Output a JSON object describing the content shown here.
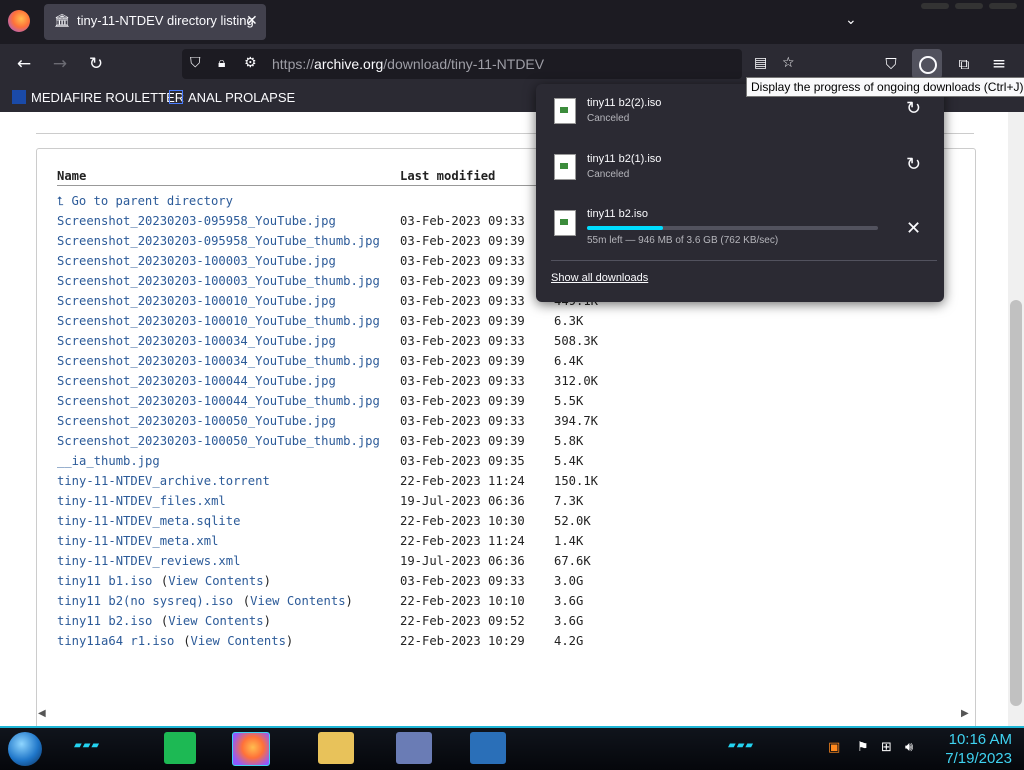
{
  "tab": {
    "title": "tiny-11-NTDEV directory listing",
    "close": "✕",
    "icon": "archive-icon"
  },
  "tab_list_icon": "⌄",
  "nav": {
    "back": "←",
    "forward": "→",
    "reload": "↻",
    "url_prefix": "https://",
    "url_host": "archive.org",
    "url_path": "/download/tiny-11-NTDEV"
  },
  "bookmarks": [
    {
      "label": "MEDIAFIRE ROULETTER"
    },
    {
      "label": "ANAL PROLAPSE"
    }
  ],
  "listing": {
    "headers": {
      "name": "Name",
      "modified": "Last modified"
    },
    "parent": "Go to parent directory",
    "view_contents": "View Contents",
    "rows": [
      {
        "name": "Screenshot_20230203-095958_YouTube.jpg",
        "date": "03-Feb-2023 09:33",
        "size": ""
      },
      {
        "name": "Screenshot_20230203-095958_YouTube_thumb.jpg",
        "date": "03-Feb-2023 09:39",
        "size": ""
      },
      {
        "name": "Screenshot_20230203-100003_YouTube.jpg",
        "date": "03-Feb-2023 09:33",
        "size": ""
      },
      {
        "name": "Screenshot_20230203-100003_YouTube_thumb.jpg",
        "date": "03-Feb-2023 09:39",
        "size": ""
      },
      {
        "name": "Screenshot_20230203-100010_YouTube.jpg",
        "date": "03-Feb-2023 09:33",
        "size": "449.1K"
      },
      {
        "name": "Screenshot_20230203-100010_YouTube_thumb.jpg",
        "date": "03-Feb-2023 09:39",
        "size": "6.3K"
      },
      {
        "name": "Screenshot_20230203-100034_YouTube.jpg",
        "date": "03-Feb-2023 09:33",
        "size": "508.3K"
      },
      {
        "name": "Screenshot_20230203-100034_YouTube_thumb.jpg",
        "date": "03-Feb-2023 09:39",
        "size": "6.4K"
      },
      {
        "name": "Screenshot_20230203-100044_YouTube.jpg",
        "date": "03-Feb-2023 09:33",
        "size": "312.0K"
      },
      {
        "name": "Screenshot_20230203-100044_YouTube_thumb.jpg",
        "date": "03-Feb-2023 09:39",
        "size": "5.5K"
      },
      {
        "name": "Screenshot_20230203-100050_YouTube.jpg",
        "date": "03-Feb-2023 09:33",
        "size": "394.7K"
      },
      {
        "name": "Screenshot_20230203-100050_YouTube_thumb.jpg",
        "date": "03-Feb-2023 09:39",
        "size": "5.8K"
      },
      {
        "name": "__ia_thumb.jpg",
        "date": "03-Feb-2023 09:35",
        "size": "5.4K"
      },
      {
        "name": "tiny-11-NTDEV_archive.torrent",
        "date": "22-Feb-2023 11:24",
        "size": "150.1K"
      },
      {
        "name": "tiny-11-NTDEV_files.xml",
        "date": "19-Jul-2023 06:36",
        "size": "7.3K"
      },
      {
        "name": "tiny-11-NTDEV_meta.sqlite",
        "date": "22-Feb-2023 10:30",
        "size": "52.0K"
      },
      {
        "name": "tiny-11-NTDEV_meta.xml",
        "date": "22-Feb-2023 11:24",
        "size": "1.4K"
      },
      {
        "name": "tiny-11-NTDEV_reviews.xml",
        "date": "19-Jul-2023 06:36",
        "size": "67.6K"
      },
      {
        "name": "tiny11 b1.iso",
        "date": "03-Feb-2023 09:33",
        "size": "3.0G",
        "view": true
      },
      {
        "name": "tiny11 b2(no sysreq).iso",
        "date": "22-Feb-2023 10:10",
        "size": "3.6G",
        "view": true
      },
      {
        "name": "tiny11 b2.iso",
        "date": "22-Feb-2023 09:52",
        "size": "3.6G",
        "view": true
      },
      {
        "name": "tiny11a64 r1.iso",
        "date": "22-Feb-2023 10:29",
        "size": "4.2G",
        "view": true
      }
    ]
  },
  "downloads": {
    "items": [
      {
        "name": "tiny11 b2(2).iso",
        "status": "Canceled",
        "action": "↻"
      },
      {
        "name": "tiny11 b2(1).iso",
        "status": "Canceled",
        "action": "↻"
      },
      {
        "name": "tiny11 b2.iso",
        "status": "55m left — 946 MB of 3.6 GB (762 KB/sec)",
        "action": "✕",
        "progress": 0.26
      }
    ],
    "show_all": "Show all downloads",
    "tooltip": "Display the progress of ongoing downloads (Ctrl+J)"
  },
  "taskbar": {
    "time": "10:16 AM",
    "date": "7/19/2023"
  },
  "colors": {
    "link": "#2c5b99",
    "accent": "#00ddff",
    "panel": "#2b2a33",
    "clock": "#3fd2f0"
  }
}
